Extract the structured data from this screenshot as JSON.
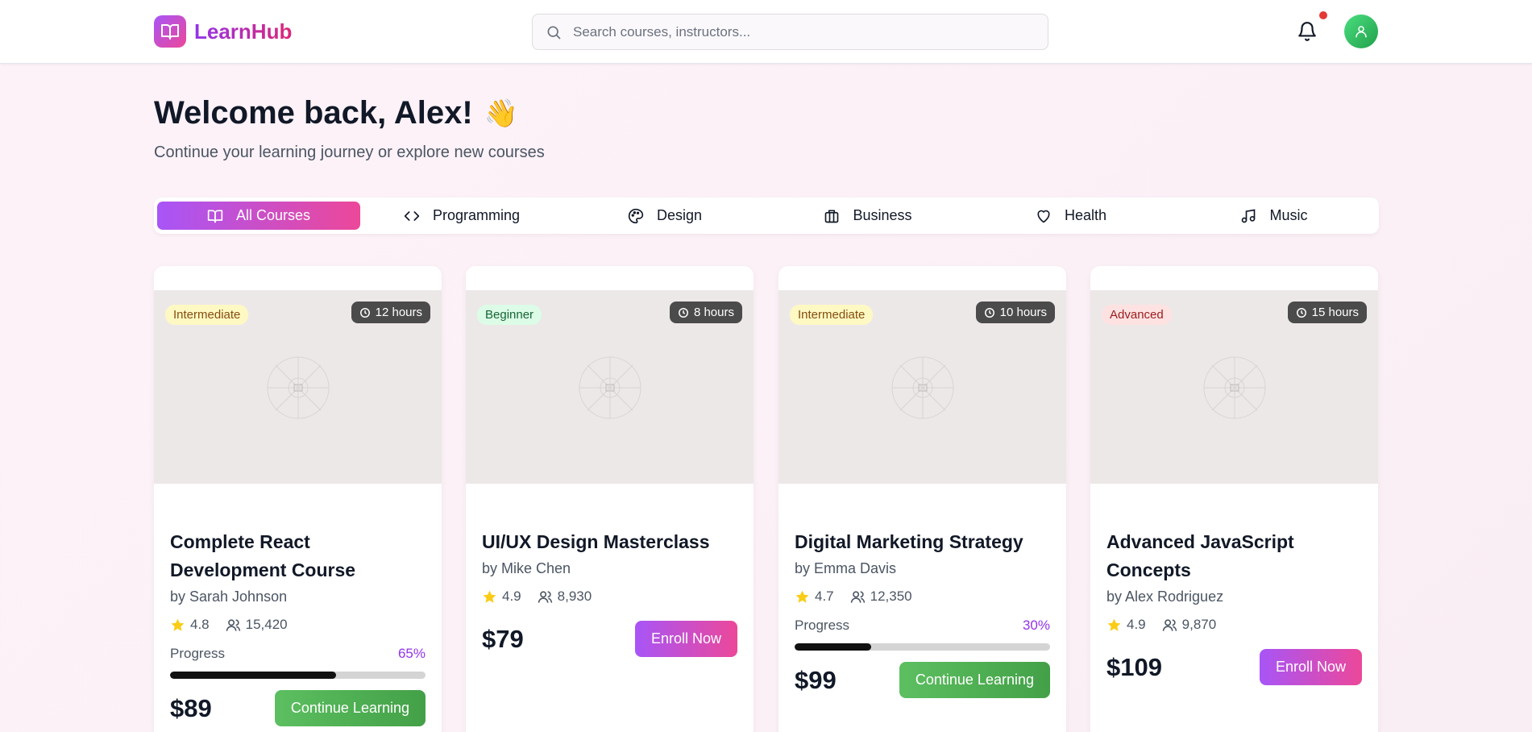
{
  "header": {
    "brand": "LearnHub",
    "search_placeholder": "Search courses, instructors...",
    "brand_gradient": [
      "#a855f7",
      "#ec4899"
    ],
    "notification_dot_color": "#e53935",
    "avatar_color": "#4ade80"
  },
  "welcome": {
    "title": "Welcome back, Alex!",
    "emoji": "👋",
    "subtitle": "Continue your learning journey or explore new courses"
  },
  "tabs": [
    {
      "label": "All Courses",
      "icon": "book-icon",
      "active": true
    },
    {
      "label": "Programming",
      "icon": "code-icon",
      "active": false
    },
    {
      "label": "Design",
      "icon": "palette-icon",
      "active": false
    },
    {
      "label": "Business",
      "icon": "briefcase-icon",
      "active": false
    },
    {
      "label": "Health",
      "icon": "heart-icon",
      "active": false
    },
    {
      "label": "Music",
      "icon": "music-icon",
      "active": false
    }
  ],
  "courses": [
    {
      "level": "Intermediate",
      "hours": "12 hours",
      "title": "Complete React Development Course",
      "instructor": "by Sarah Johnson",
      "rating": "4.8",
      "students": "15,420",
      "progress_label": "Progress",
      "progress": "65%",
      "price": "$89",
      "action": "Continue Learning"
    },
    {
      "level": "Beginner",
      "hours": "8 hours",
      "title": "UI/UX Design Masterclass",
      "instructor": "by Mike Chen",
      "rating": "4.9",
      "students": "8,930",
      "price": "$79",
      "action": "Enroll Now"
    },
    {
      "level": "Intermediate",
      "hours": "10 hours",
      "title": "Digital Marketing Strategy",
      "instructor": "by Emma Davis",
      "rating": "4.7",
      "students": "12,350",
      "progress_label": "Progress",
      "progress": "30%",
      "price": "$99",
      "action": "Continue Learning"
    },
    {
      "level": "Advanced",
      "hours": "15 hours",
      "title": "Advanced JavaScript Concepts",
      "instructor": "by Alex Rodriguez",
      "rating": "4.9",
      "students": "9,870",
      "price": "$109",
      "action": "Enroll Now"
    }
  ]
}
